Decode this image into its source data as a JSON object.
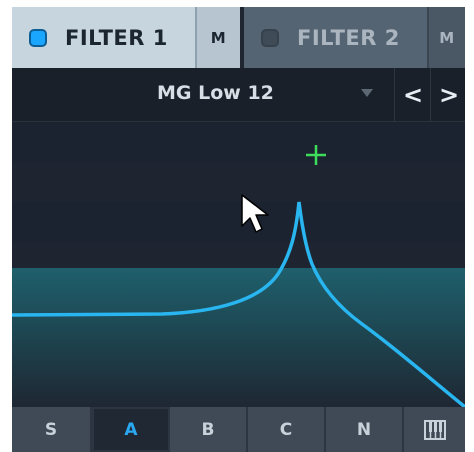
{
  "tabs": [
    {
      "label": "FILTER 1",
      "enabled": true,
      "mode_label": "M"
    },
    {
      "label": "FILTER 2",
      "enabled": false,
      "mode_label": "M"
    }
  ],
  "preset": {
    "name": "MG Low 12",
    "prev_label": "<",
    "next_label": ">"
  },
  "mode_buttons": [
    {
      "label": "S",
      "active": false
    },
    {
      "label": "A",
      "active": true
    },
    {
      "label": "B",
      "active": false
    },
    {
      "label": "C",
      "active": false
    },
    {
      "label": "N",
      "active": false
    },
    {
      "label": "keyboard-icon",
      "active": false
    }
  ],
  "colors": {
    "accent": "#1aa6ff",
    "curve": "#29b6f0",
    "fill": "#1f5f6c",
    "cutoff_marker": "#3ddc5a"
  }
}
